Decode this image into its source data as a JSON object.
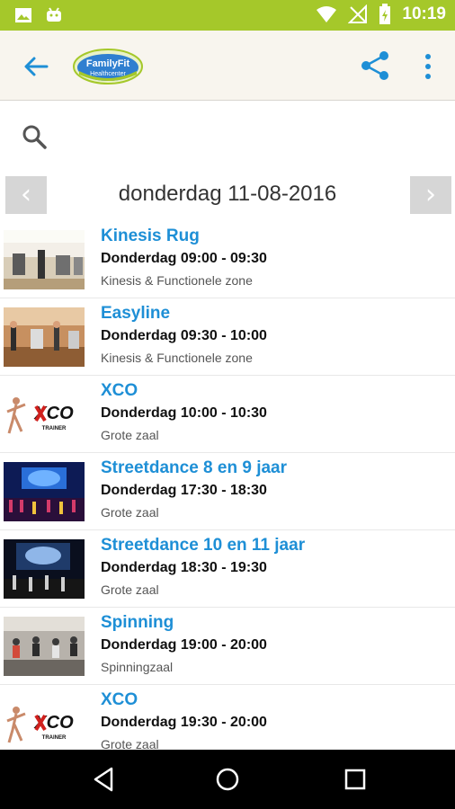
{
  "status_bar": {
    "time": "10:19",
    "left_icons": [
      "image-icon",
      "android-icon"
    ],
    "right_icons": [
      "wifi-icon",
      "no-signal-icon",
      "battery-icon"
    ]
  },
  "app_bar": {
    "logo_text_top": "FamilyFit",
    "logo_text_bottom": "Healthcenter",
    "colors": {
      "background": "#f8f5ee",
      "accent": "#1e8fd6"
    }
  },
  "date_nav": {
    "prev_label": "‹",
    "date": "donderdag 11-08-2016",
    "next_label": "›"
  },
  "classes": [
    {
      "title": "Kinesis Rug",
      "time": "Donderdag 09:00 - 09:30",
      "room": "Kinesis & Functionele zone",
      "image": "gym-photo"
    },
    {
      "title": "Easyline",
      "time": "Donderdag 09:30 - 10:00",
      "room": "Kinesis & Functionele zone",
      "image": "gym-photo"
    },
    {
      "title": "XCO",
      "time": "Donderdag 10:00 - 10:30",
      "room": "Grote zaal",
      "image": "xco-trainer-logo",
      "logo_text": "XCO",
      "logo_sub": "TRAINER"
    },
    {
      "title": "Streetdance 8 en 9 jaar",
      "time": "Donderdag 17:30 - 18:30",
      "room": "Grote zaal",
      "image": "stage-photo"
    },
    {
      "title": "Streetdance 10 en 11 jaar",
      "time": "Donderdag 18:30 - 19:30",
      "room": "Grote zaal",
      "image": "stage-photo"
    },
    {
      "title": "Spinning",
      "time": "Donderdag 19:00 - 20:00",
      "room": "Spinningzaal",
      "image": "spinning-photo"
    },
    {
      "title": "XCO",
      "time": "Donderdag 19:30 - 20:00",
      "room": "Grote zaal",
      "image": "xco-trainer-logo",
      "logo_text": "XCO",
      "logo_sub": "TRAINER"
    }
  ]
}
